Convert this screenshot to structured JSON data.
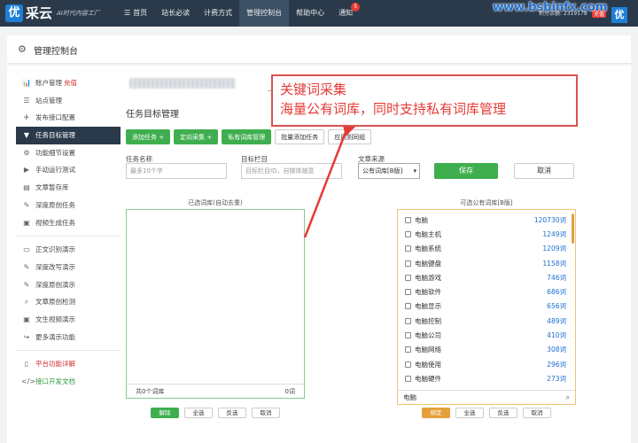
{
  "brand": {
    "logo_char": "优",
    "name": "采云",
    "slogan": "AI时代内容工厂"
  },
  "nav": [
    {
      "label": "首页",
      "icon": "☰"
    },
    {
      "label": "站长必读"
    },
    {
      "label": "计费方式"
    },
    {
      "label": "管理控制台",
      "active": true
    },
    {
      "label": "帮助中心"
    },
    {
      "label": "通知",
      "badge": "5"
    }
  ],
  "account": {
    "balance": "积分余额: 2319178",
    "vip": "充值",
    "avatar_char": "优"
  },
  "watermark": "www.bsbinfx.com",
  "header": {
    "title": "管理控制台"
  },
  "sidebar": {
    "group1": [
      {
        "label": "账户管理",
        "extra": "充值",
        "icon": "chart"
      },
      {
        "label": "站点管理",
        "icon": "list"
      },
      {
        "label": "发布接口配置",
        "icon": "send"
      },
      {
        "label": "任务目标管理",
        "icon": "filter",
        "active": true
      },
      {
        "label": "功能细节设置",
        "icon": "gear"
      },
      {
        "label": "手动运行测试",
        "icon": "play"
      },
      {
        "label": "文章暂存库",
        "icon": "db"
      },
      {
        "label": "深度原创任务",
        "icon": "edit"
      },
      {
        "label": "视频生成任务",
        "icon": "video"
      }
    ],
    "group2": [
      {
        "label": "正文识别演示",
        "icon": "monitor"
      },
      {
        "label": "深度改写演示",
        "icon": "edit"
      },
      {
        "label": "深度原创演示",
        "icon": "edit"
      },
      {
        "label": "文章原创检测",
        "icon": "search"
      },
      {
        "label": "文生视频演示",
        "icon": "video"
      },
      {
        "label": "更多演示功能",
        "icon": "share"
      }
    ],
    "group3": [
      {
        "label": "平台功能详解",
        "icon": "doc",
        "color": "red"
      },
      {
        "label": "接口开发文档",
        "icon": "code",
        "color": "green"
      }
    ]
  },
  "main": {
    "section_title": "任务目标管理",
    "buttons": [
      {
        "label": "添加任务 +",
        "style": "green"
      },
      {
        "label": "定向采集 +",
        "style": "green"
      },
      {
        "label": "私有词库管理",
        "style": "green"
      },
      {
        "label": "批量添加任务",
        "style": "white"
      },
      {
        "label": "应用到同组",
        "style": "white"
      }
    ],
    "form": {
      "task_name_label": "任务名称",
      "task_name_placeholder": "最多10个字",
      "target_label": "目标栏目",
      "target_placeholder": "目标栏目ID，自媒体随意",
      "source_label": "文章来源",
      "source_value": "公有词库[B版]",
      "save_label": "保存",
      "cancel_label": "取消"
    },
    "selected": {
      "title": "已选词库(自动去重)",
      "footer_left": "共0个词库",
      "footer_right": "0词",
      "buttons": [
        "解除",
        "全选",
        "反选",
        "取消"
      ]
    },
    "available": {
      "title": "可选公有词库[B版]",
      "items": [
        {
          "name": "电脑",
          "count": "120730词"
        },
        {
          "name": "电脑主机",
          "count": "1249词"
        },
        {
          "name": "电脑系统",
          "count": "1209词"
        },
        {
          "name": "电脑键盘",
          "count": "1158词"
        },
        {
          "name": "电脑游戏",
          "count": "746词"
        },
        {
          "name": "电脑软件",
          "count": "686词"
        },
        {
          "name": "电脑显示",
          "count": "656词"
        },
        {
          "name": "电脑控制",
          "count": "489词"
        },
        {
          "name": "电脑公司",
          "count": "410词"
        },
        {
          "name": "电脑网络",
          "count": "308词"
        },
        {
          "name": "电脑使用",
          "count": "296词"
        },
        {
          "name": "电脑硬件",
          "count": "273词"
        }
      ],
      "search_value": "电脑",
      "buttons": [
        "绑定",
        "全选",
        "反选",
        "取消"
      ]
    }
  },
  "callout": {
    "line1": "关键词采集",
    "line2": "海量公有词库，同时支持私有词库管理"
  }
}
